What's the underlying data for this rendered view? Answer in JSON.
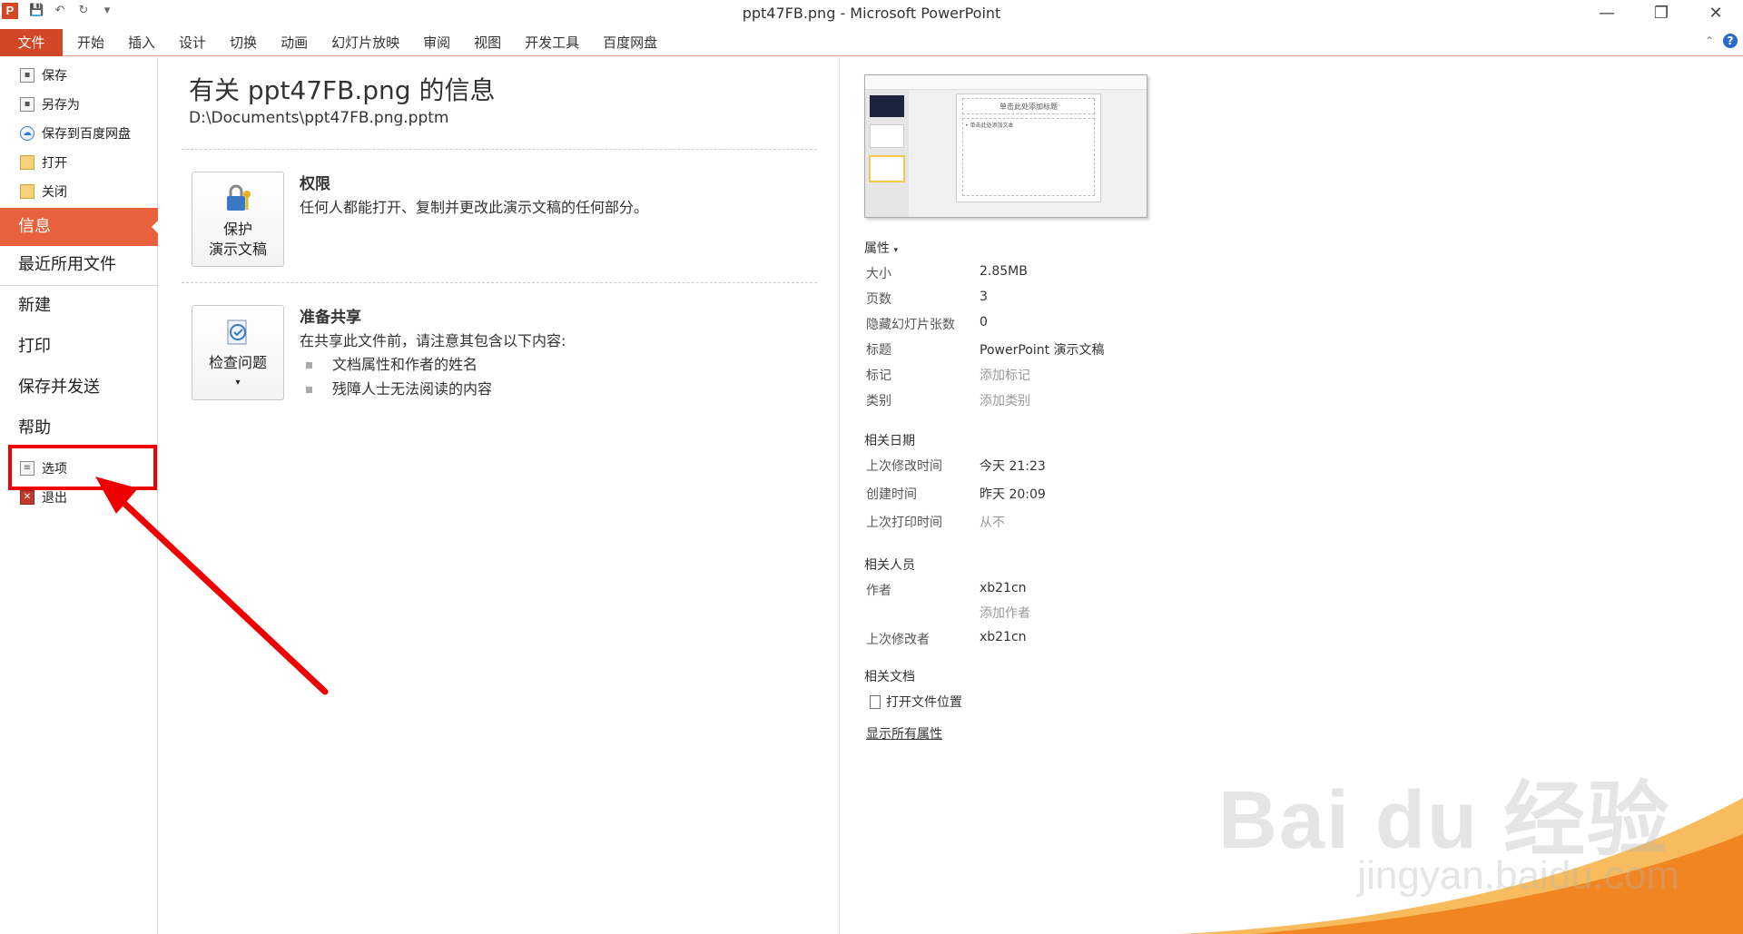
{
  "window": {
    "title": "ppt47FB.png - Microsoft PowerPoint",
    "app_logo": "P",
    "controls": {
      "minimize": "—",
      "restore": "❐",
      "close": "✕"
    }
  },
  "qat": {
    "save_icon": "💾",
    "undo_icon": "↶",
    "redo_icon": "↻",
    "customize_icon": "▾"
  },
  "ribbon": {
    "file_tab": "文件",
    "tabs": [
      "开始",
      "插入",
      "设计",
      "切换",
      "动画",
      "幻灯片放映",
      "审阅",
      "视图",
      "开发工具",
      "百度网盘"
    ],
    "collapse_icon": "⌃",
    "help_icon": "?"
  },
  "nav": {
    "save": "保存",
    "save_as": "另存为",
    "save_baidu": "保存到百度网盘",
    "open": "打开",
    "close": "关闭",
    "info": "信息",
    "recent": "最近所用文件",
    "new": "新建",
    "print": "打印",
    "save_send": "保存并发送",
    "help": "帮助",
    "options": "选项",
    "exit": "退出"
  },
  "main": {
    "title": "有关 ppt47FB.png 的信息",
    "path": "D:\\Documents\\ppt47FB.png.pptm",
    "permissions": {
      "button_line1": "保护",
      "button_line2": "演示文稿",
      "title": "权限",
      "text": "任何人都能打开、复制并更改此演示文稿的任何部分。"
    },
    "share": {
      "button_label": "检查问题",
      "title": "准备共享",
      "text": "在共享此文件前，请注意其包含以下内容:",
      "bullets": [
        "文档属性和作者的姓名",
        "残障人士无法阅读的内容"
      ]
    }
  },
  "thumbnail": {
    "slide_title": "单击此处添加标题",
    "slide_body": "• 单击此处添加文本"
  },
  "properties": {
    "header": "属性",
    "rows": [
      {
        "key": "大小",
        "value": "2.85MB"
      },
      {
        "key": "页数",
        "value": "3"
      },
      {
        "key": "隐藏幻灯片张数",
        "value": "0"
      },
      {
        "key": "标题",
        "value": "PowerPoint 演示文稿"
      },
      {
        "key": "标记",
        "value": "添加标记"
      },
      {
        "key": "类别",
        "value": "添加类别"
      }
    ],
    "dates_header": "相关日期",
    "dates": [
      {
        "key": "上次修改时间",
        "value": "今天 21:23"
      },
      {
        "key": "创建时间",
        "value": "昨天 20:09"
      },
      {
        "key": "上次打印时间",
        "value": "从不"
      }
    ],
    "people_header": "相关人员",
    "people": [
      {
        "key": "作者",
        "value": "xb21cn"
      },
      {
        "key": "",
        "value": "添加作者"
      },
      {
        "key": "上次修改者",
        "value": "xb21cn"
      }
    ],
    "docs_header": "相关文档",
    "open_location": "打开文件位置",
    "show_all": "显示所有属性"
  },
  "watermark": {
    "brand": "Bai du 经验",
    "url": "jingyan.baidu.com"
  }
}
